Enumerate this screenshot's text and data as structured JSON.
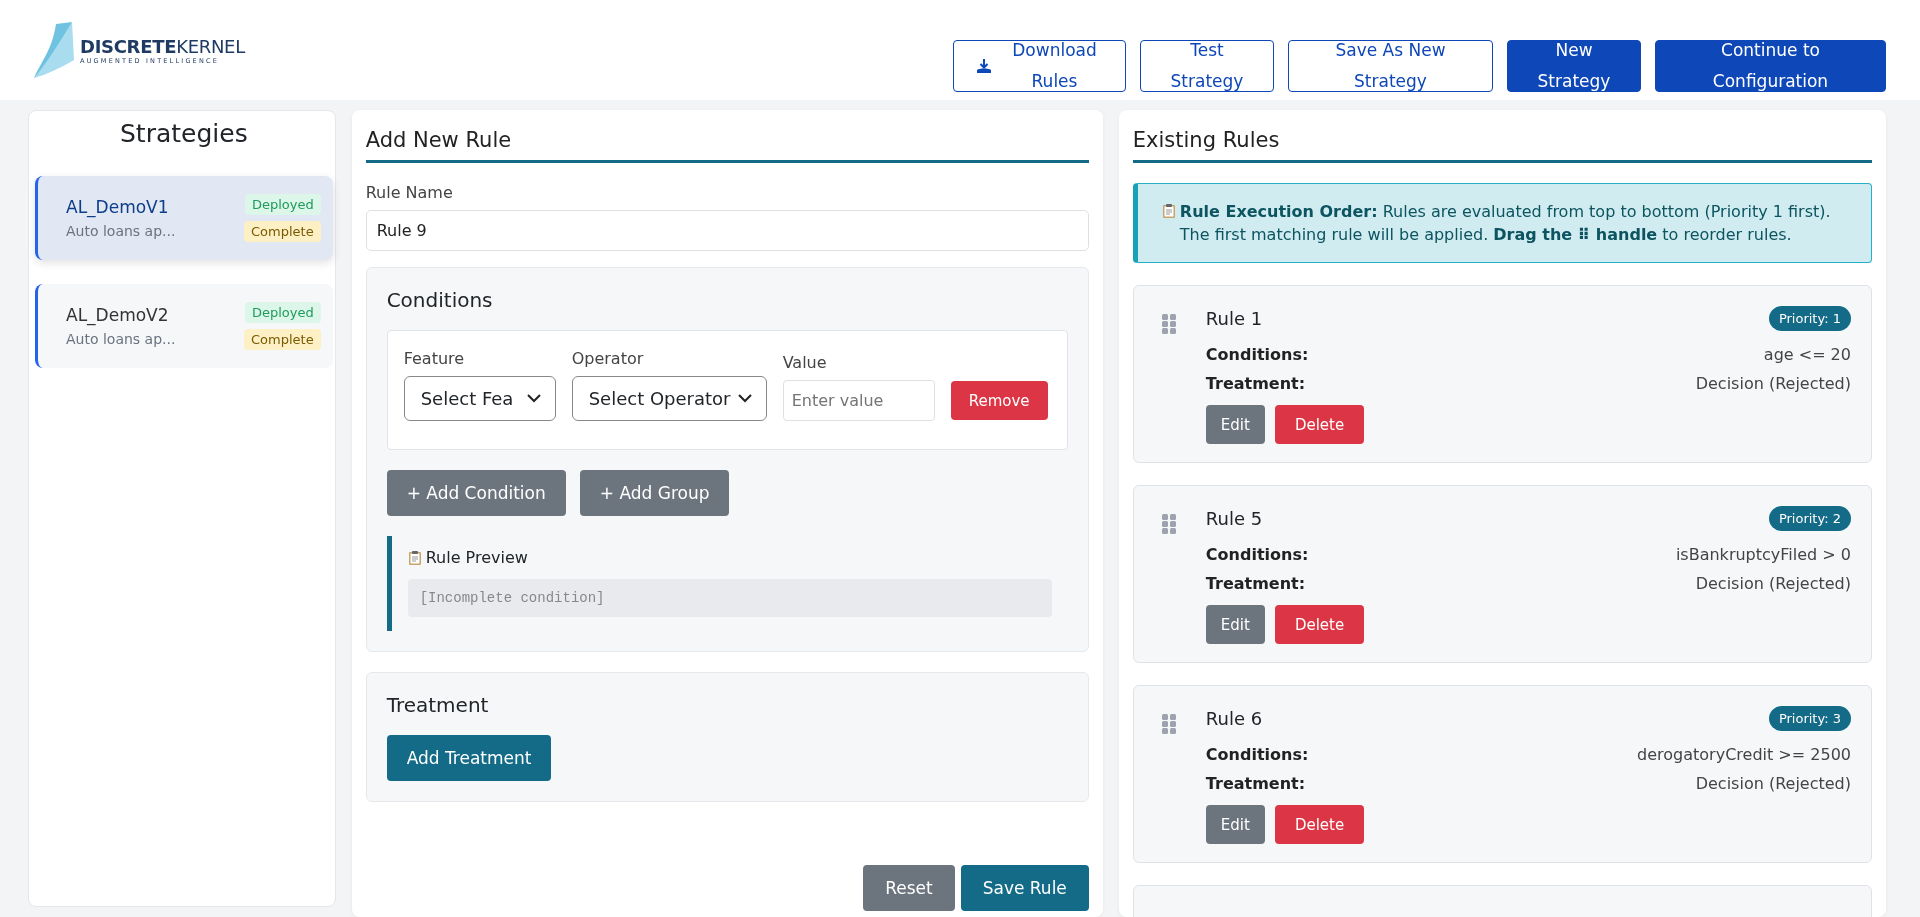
{
  "brand": {
    "name_bold": "DISCRETE",
    "name_light": "KERNEL",
    "tagline": "AUGMENTED INTELLIGENCE"
  },
  "header_buttons": [
    {
      "label": "Download Rules",
      "kind": "outline_download"
    },
    {
      "label": "Test Strategy",
      "kind": "outline"
    },
    {
      "label": "Save As New Strategy",
      "kind": "outline"
    },
    {
      "label": "New Strategy",
      "kind": "solid"
    },
    {
      "label": "Continue to Configuration",
      "kind": "solid"
    }
  ],
  "strategies": {
    "title": "Strategies",
    "items": [
      {
        "name": "AL_DemoV1",
        "description": "Auto loans ap...",
        "selected": true,
        "badges": [
          {
            "label": "Deployed",
            "kind": "success"
          },
          {
            "label": "Complete",
            "kind": "warning"
          }
        ]
      },
      {
        "name": "AL_DemoV2",
        "description": "Auto loans ap...",
        "selected": false,
        "badges": [
          {
            "label": "Deployed",
            "kind": "success"
          },
          {
            "label": "Complete",
            "kind": "warning"
          }
        ]
      }
    ]
  },
  "add_rule": {
    "title": "Add New Rule",
    "rule_name_label": "Rule Name",
    "rule_name_value": "Rule 9",
    "conditions": {
      "title": "Conditions",
      "feature_label": "Feature",
      "feature_value": "Select Fea",
      "operator_label": "Operator",
      "operator_value": "Select Operator",
      "value_label": "Value",
      "value_placeholder": "Enter value",
      "remove": "Remove",
      "add_condition": "+ Add Condition",
      "add_group": "+ Add Group",
      "preview_title": "Rule Preview",
      "preview_text": "[Incomplete condition]"
    },
    "treatment": {
      "title": "Treatment",
      "add_treatment": "Add Treatment"
    },
    "reset": "Reset",
    "save": "Save Rule"
  },
  "existing_rules": {
    "title": "Existing Rules",
    "info": "**Rule Execution Order:** Rules are evaluated from top to bottom (Priority 1 first). The first matching rule will be applied. **Drag the ⠿ handle** to reorder rules.",
    "rules": [
      {
        "name": "Rule 1",
        "priority": "Priority: 1",
        "conditions_label": "Conditions:",
        "conditions": "age <= 20",
        "treatment_label": "Treatment:",
        "treatment": "Decision (Rejected)",
        "edit": "Edit",
        "delete": "Delete"
      },
      {
        "name": "Rule 5",
        "priority": "Priority: 2",
        "conditions_label": "Conditions:",
        "conditions": "isBankruptcyFiled > 0",
        "treatment_label": "Treatment:",
        "treatment": "Decision (Rejected)",
        "edit": "Edit",
        "delete": "Delete"
      },
      {
        "name": "Rule 6",
        "priority": "Priority: 3",
        "conditions_label": "Conditions:",
        "conditions": "derogatoryCredit >= 2500",
        "treatment_label": "Treatment:",
        "treatment": "Decision (Rejected)",
        "edit": "Edit",
        "delete": "Delete"
      }
    ]
  }
}
